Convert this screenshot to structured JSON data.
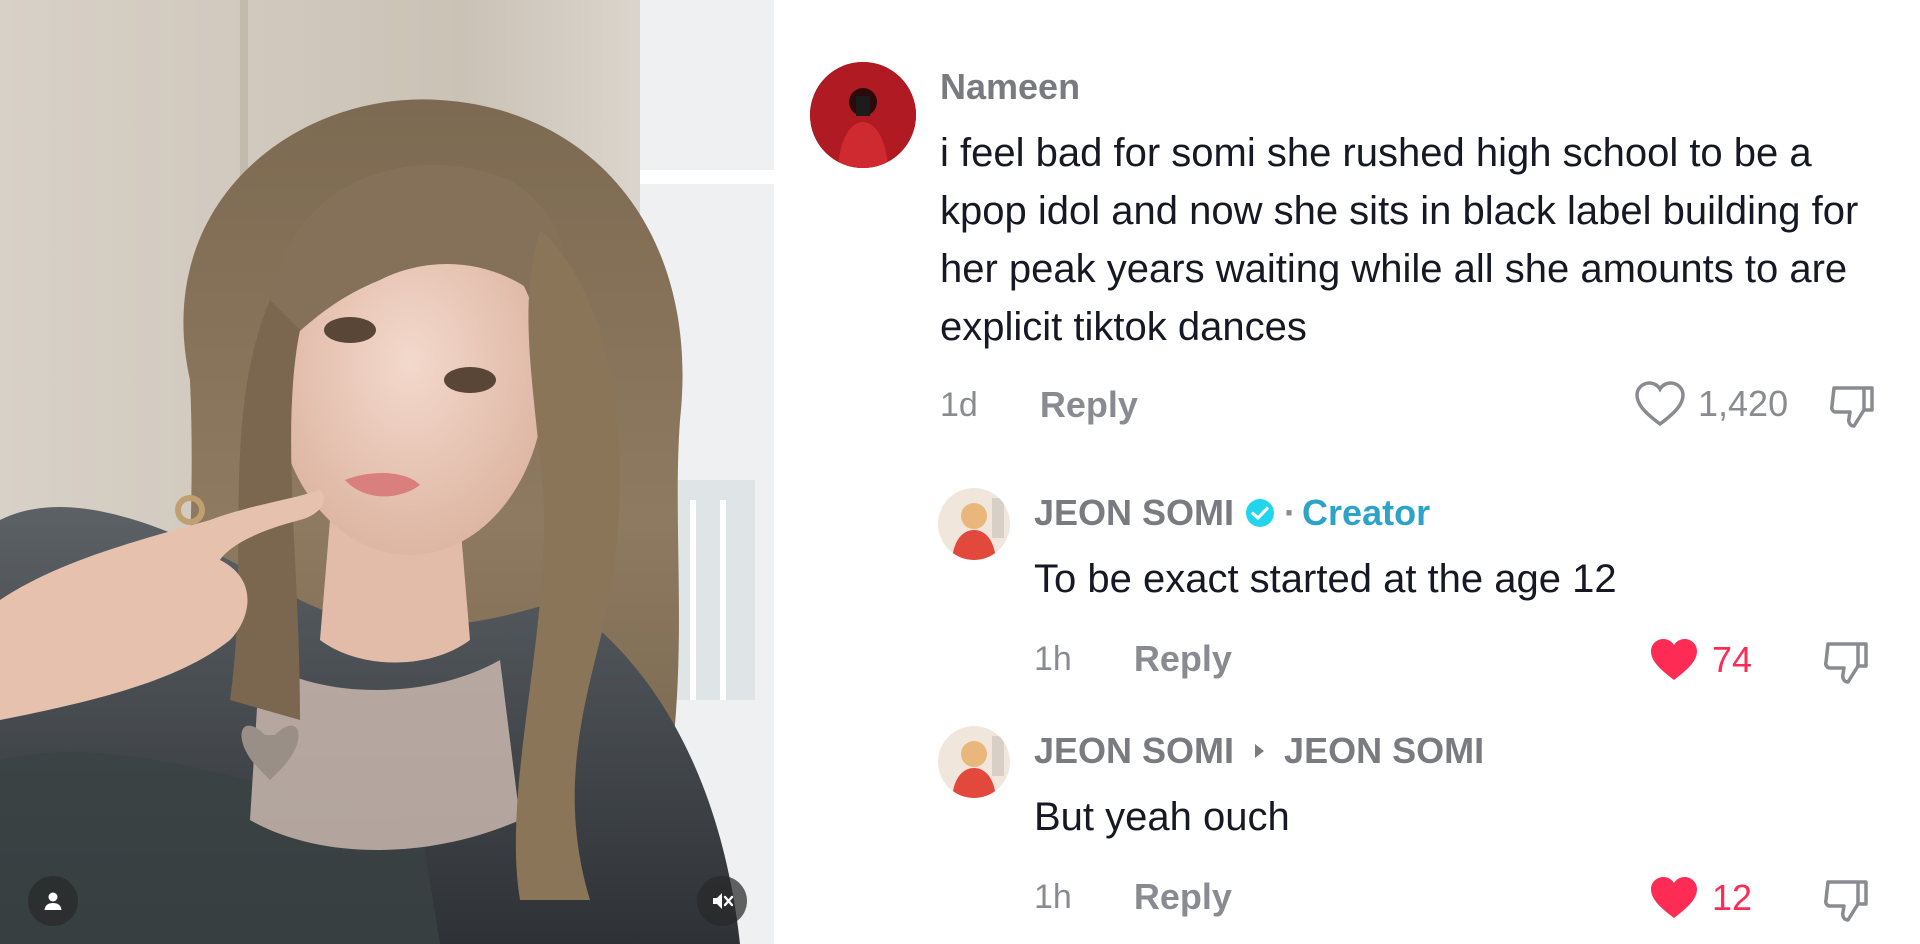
{
  "comments": [
    {
      "author": "Nameen",
      "text": "i feel bad for somi she rushed high school to be a kpop idol and now she sits in black label building for her peak years waiting while all she amounts to are explicit tiktok dances",
      "time": "1d",
      "reply_label": "Reply",
      "likes": "1,420",
      "liked": false
    },
    {
      "author": "JEON SOMI",
      "separator": "·",
      "badge": "Creator",
      "text": "To be exact started at the age 12",
      "time": "1h",
      "reply_label": "Reply",
      "likes": "74",
      "liked": true
    },
    {
      "author": "JEON SOMI",
      "reply_to": "JEON SOMI",
      "text": "But yeah ouch",
      "time": "1h",
      "reply_label": "Reply",
      "likes": "12",
      "liked": true
    }
  ],
  "colors": {
    "like_active": "#fe2c55",
    "creator_accent": "#2da3c9",
    "muted_text": "#8a8b91",
    "body_text": "#161823"
  },
  "icons": {
    "profile_badge": "person-icon",
    "mute_badge": "speaker-muted-icon",
    "like": "heart-icon",
    "dislike": "thumbs-down-icon",
    "verified": "verified-check-icon",
    "reply_arrow": "triangle-right-icon"
  }
}
